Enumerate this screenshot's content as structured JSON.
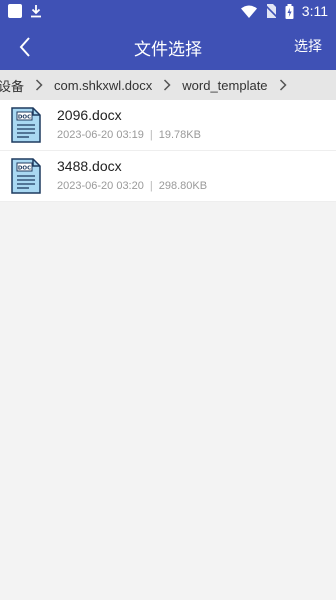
{
  "status_bar": {
    "time": "3:11",
    "icons": [
      "notification-square-icon",
      "download-icon",
      "wifi-icon",
      "no-sim-icon",
      "battery-charging-icon"
    ]
  },
  "app_bar": {
    "title": "文件选择",
    "select_label": "选择",
    "back_icon": "chevron-left-icon",
    "color": "#3f51b5"
  },
  "breadcrumb": {
    "items": [
      {
        "label": "设备"
      },
      {
        "label": "com.shkxwl.docx"
      },
      {
        "label": "word_template"
      }
    ]
  },
  "files": [
    {
      "name": "2096.docx",
      "date": "2023-06-20 03:19",
      "size": "19.78KB",
      "icon": "docx-file-icon",
      "badge": "DOC"
    },
    {
      "name": "3488.docx",
      "date": "2023-06-20 03:20",
      "size": "298.80KB",
      "icon": "docx-file-icon",
      "badge": "DOC"
    }
  ],
  "meta_separator": "|"
}
